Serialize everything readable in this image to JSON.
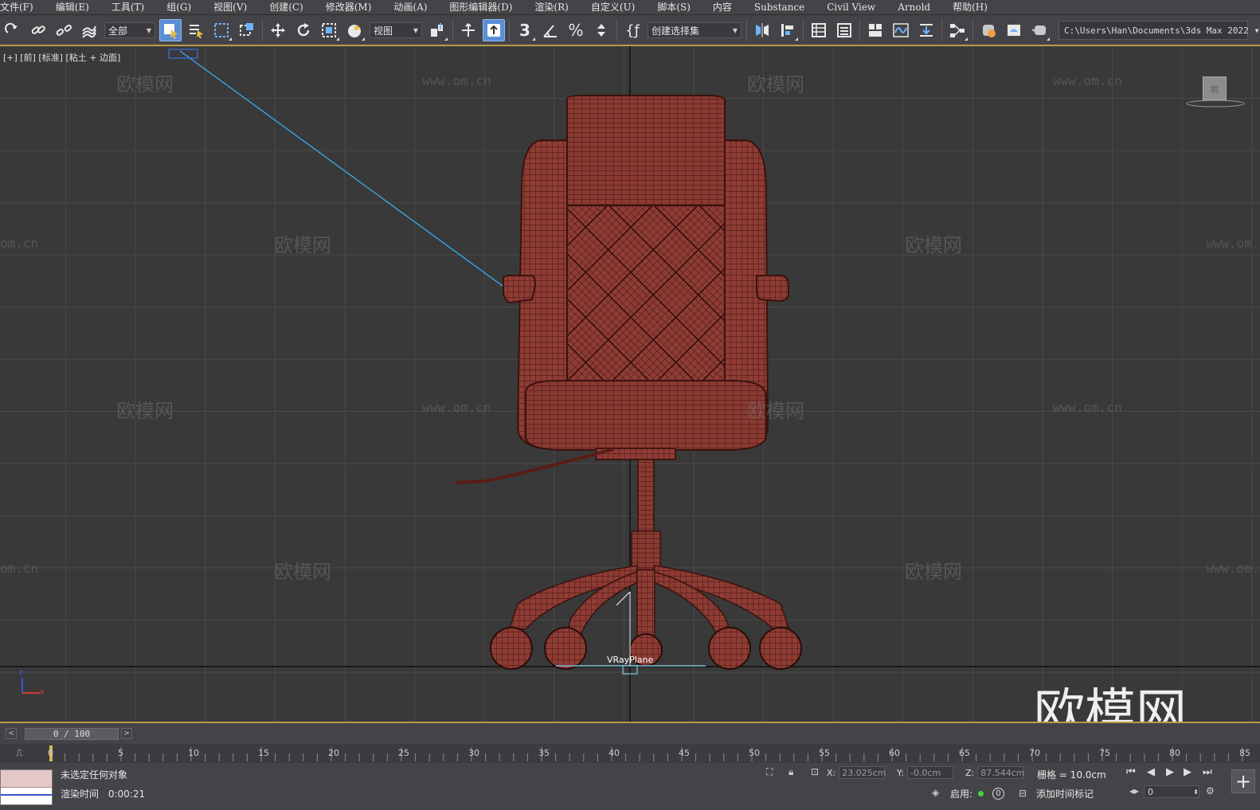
{
  "menu": [
    "文件(F)",
    "编辑(E)",
    "工具(T)",
    "组(G)",
    "视图(V)",
    "创建(C)",
    "修改器(M)",
    "动画(A)",
    "图形编辑器(D)",
    "渲染(R)",
    "自定义(U)",
    "脚本(S)",
    "内容",
    "Substance",
    "Civil View",
    "Arnold",
    "帮助(H)"
  ],
  "toolbar": {
    "filter_value": "全部",
    "refcoord_value": "视图",
    "selection_set_value": "创建选择集",
    "path": "C:\\Users\\Han\\Documents\\3ds Max 2022",
    "snap_number": "3",
    "accent": "#5a8fd6"
  },
  "viewport": {
    "label": "[+] [前] [标准] [粘土 + 边面]",
    "object_label": "VRayPlane",
    "viewcube_text": "前",
    "watermarks_cn": "欧模网",
    "watermarks_url": "www.om.cn",
    "watermark_url_partial": "om.cn",
    "big_watermark": "欧模网",
    "mesh_color": "#8b3a32",
    "grid_bg": "#393939",
    "axis_z": "z",
    "axis_x": "x",
    "axis_y": "y"
  },
  "timeline": {
    "frame_display": "0 / 100",
    "ticks": [
      "0",
      "5",
      "10",
      "15",
      "20",
      "25",
      "30",
      "35",
      "40",
      "45",
      "50",
      "55",
      "60",
      "65",
      "70",
      "75",
      "80",
      "85"
    ]
  },
  "status": {
    "message": "未选定任何对象",
    "render_time_label": "渲染时间",
    "render_time_value": "0:00:21",
    "x_label": "X:",
    "x_value": "23.025cm",
    "y_label": "Y:",
    "y_value": "-0.0cm",
    "z_label": "Z:",
    "z_value": "87.544cm",
    "grid_label": "栅格 = 10.0cm",
    "enable_label": "启用:",
    "add_time_tag": "添加时间标记",
    "current_frame": "0",
    "key_count": "0"
  }
}
